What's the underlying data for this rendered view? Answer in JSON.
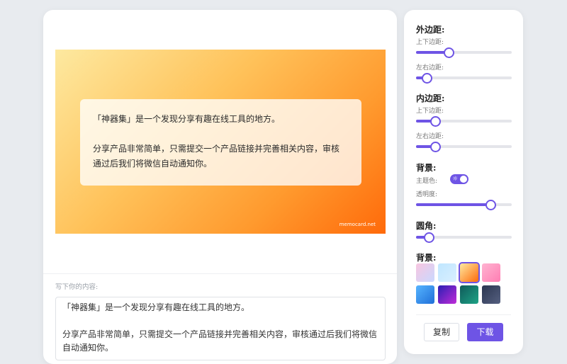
{
  "preview": {
    "line1": "「神器集」是一个发现分享有趣在线工具的地方。",
    "line2": "分享产品非常简单，只需提交一个产品链接并完善相关内容，审核",
    "line3": "通过后我们将微信自动通知你。",
    "watermark": "memocard.net"
  },
  "editor": {
    "label": "写下你的内容:",
    "line1": "「神器集」是一个发现分享有趣在线工具的地方。",
    "line2": "分享产品非常简单，只需提交一个产品链接并完善相关内容，审核通过后我们将微信",
    "line3": "自动通知你。"
  },
  "panel": {
    "margin_title": "外边距:",
    "margin_vertical_label": "上下边距:",
    "margin_horizontal_label": "左右边距:",
    "padding_title": "内边距:",
    "padding_vertical_label": "上下边距:",
    "padding_horizontal_label": "左右边距:",
    "background_title": "背景:",
    "theme_label": "主题色:",
    "theme_toggle_on": true,
    "opacity_label": "透明度:",
    "radius_title": "圆角:",
    "bg_swatches_title": "背景:",
    "copy_label": "复制",
    "download_label": "下载"
  },
  "sliders": {
    "margin_vertical": 0.34,
    "margin_horizontal": 0.11,
    "padding_vertical": 0.2,
    "padding_horizontal": 0.2,
    "opacity": 0.78,
    "radius": 0.13
  },
  "swatches": {
    "selected_index": 2,
    "colors": [
      [
        "#f8c6e0",
        "#c9d8ff"
      ],
      [
        "#bfe6ff",
        "#d9efff"
      ],
      [
        "#fde9a0",
        "#ff6a0a"
      ],
      [
        "#ffb3d1",
        "#ff7eb3"
      ],
      [
        "#56b4ff",
        "#1f6fd8"
      ],
      [
        "#2a1fb3",
        "#c02bd8"
      ],
      [
        "#0f5a5a",
        "#1fa386"
      ],
      [
        "#2b3550",
        "#556080"
      ]
    ]
  },
  "colors": {
    "accent": "#6e54e5",
    "page_bg": "#e8ebef"
  }
}
